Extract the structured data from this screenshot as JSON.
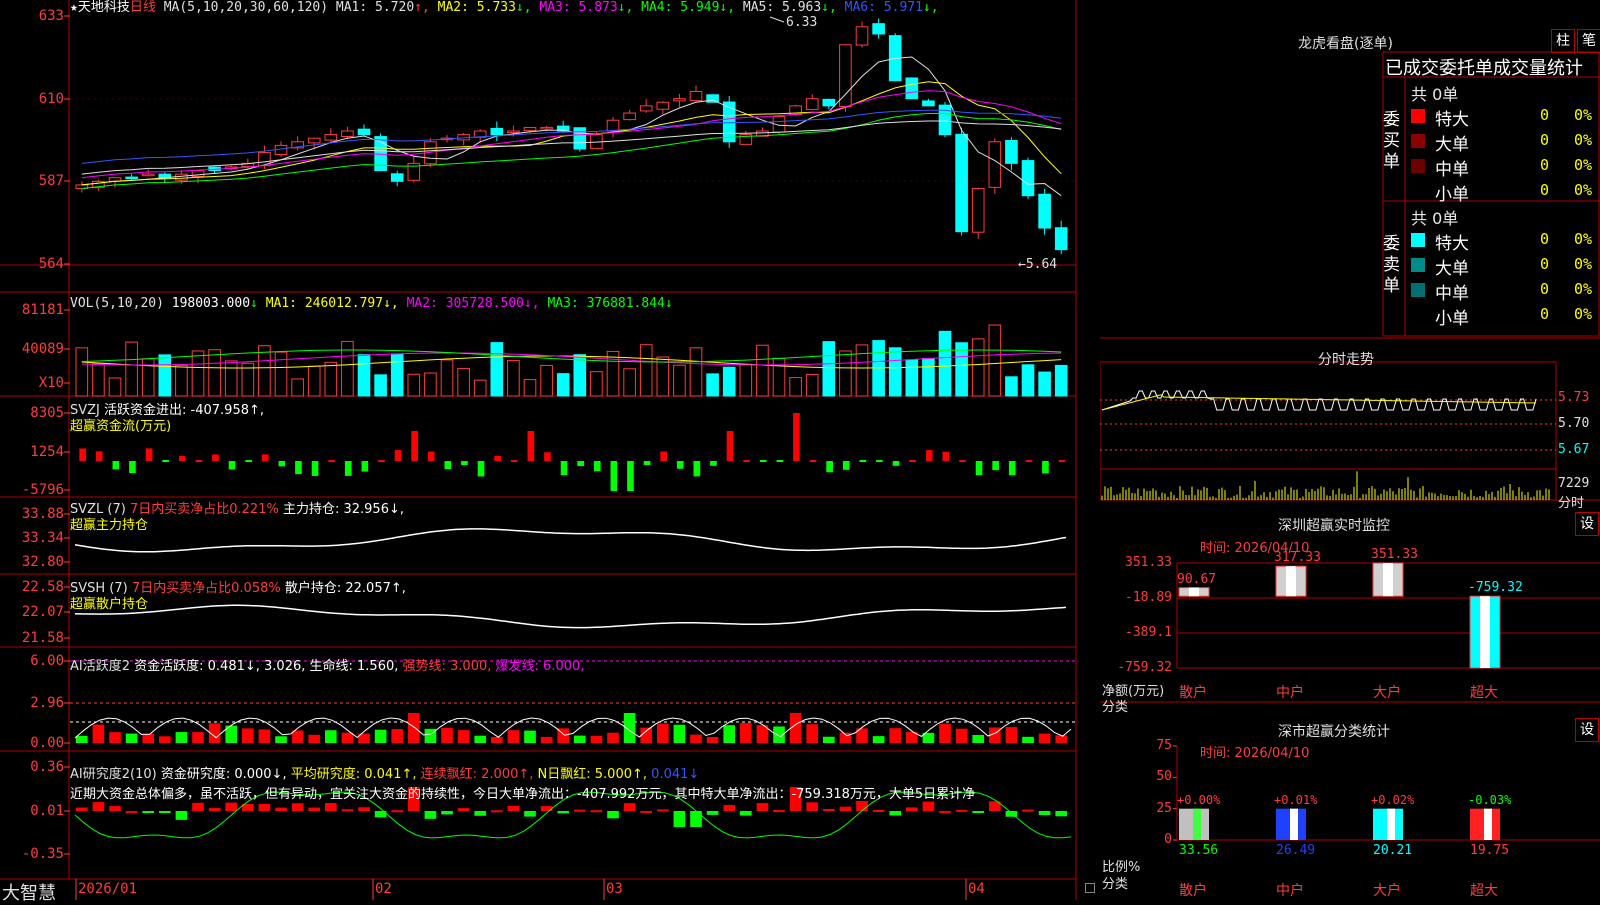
{
  "app": {
    "brand": "大智慧"
  },
  "stock": {
    "star": "★",
    "name": "天地科技",
    "period": "日线"
  },
  "kline_header": {
    "ma_label": "MA(5,10,20,30,60,120)",
    "items": [
      {
        "label": "MA1:",
        "value": "5.720",
        "arrow": "↑",
        "color": "#e0e0e0"
      },
      {
        "label": "MA2:",
        "value": "5.733",
        "arrow": "↓",
        "color": "#ffff00"
      },
      {
        "label": "MA3:",
        "value": "5.873",
        "arrow": "↓",
        "color": "#ff00ff"
      },
      {
        "label": "MA4:",
        "value": "5.949",
        "arrow": "↓",
        "color": "#00ff00"
      },
      {
        "label": "MA5:",
        "value": "5.963",
        "arrow": "↓",
        "color": "#e0e0e0"
      },
      {
        "label": "MA6:",
        "value": "5.971",
        "arrow": "↓",
        "color": "#3355ff"
      }
    ],
    "high_mark": "6.33",
    "low_mark": "←5.64"
  },
  "kline_yaxis": [
    "633",
    "610",
    "587",
    "564"
  ],
  "vol_header": {
    "label": "VOL(5,10,20)",
    "value": "198003.000",
    "arrow": "↓",
    "ma1": "MA1: 246012.797↓,",
    "ma2": "MA2: 305728.500↓,",
    "ma3": "MA3: 376881.844↓"
  },
  "vol_yaxis": [
    "81181",
    "40089",
    "X10"
  ],
  "svzj_header": {
    "label": "SVZJ",
    "text": "活跃资金进出: -407.958↑,",
    "sub": "超赢资金流(万元)"
  },
  "svzj_yaxis": [
    "8305",
    "1254",
    "-5796"
  ],
  "svzl_header": {
    "label": "SVZL (7)",
    "ratio": "7日内买卖净占比0.221%",
    "text": "主力持仓: 32.956↓,",
    "sub": "超赢主力持仓"
  },
  "svzl_yaxis": [
    "33.88",
    "33.34",
    "32.80"
  ],
  "svsh_header": {
    "label": "SVSH (7)",
    "ratio": "7日内买卖净占比0.058%",
    "text": "散户持仓: 22.057↑,",
    "sub": "超赢散户持仓"
  },
  "svsh_yaxis": [
    "22.58",
    "22.07",
    "21.58"
  ],
  "ai1_header": {
    "label": "AI活跃度2",
    "text": "资金活跃度: 0.481↓, 3.026, 生命线: 1.560,",
    "strong": "强势线: 3.000,",
    "burst": "爆发线: 6.000,"
  },
  "ai1_yaxis": [
    "6.00",
    "2.96",
    "0.00"
  ],
  "ai2_header": {
    "label": "AI研究度2(10)",
    "text": "资金研究度: 0.000↓,",
    "avg": "平均研究度: 0.041↑,",
    "cont": "连续飘红: 2.000↑,",
    "nday": "N日飘红: 5.000↑,",
    "last": "0.041↓"
  },
  "ai2_comment": "近期大资金总体偏多，虽不活跃，但有异动，宜关注大资金的持续性，今日大单净流出：-407.992万元，其中特大单净流出：-759.318万元，大单5日累计净",
  "ai2_yaxis": [
    "0.36",
    "0.01",
    "-0.35"
  ],
  "xaxis": [
    "2026/01",
    "02",
    "03",
    "04"
  ],
  "longhu": {
    "title": "龙虎看盘(逐单)",
    "btn_bar": "柱",
    "btn_pen": "笔",
    "subtitle": "已成交委托单成交量统计",
    "buy_side": "委买单",
    "sell_side": "委卖单",
    "buy_total": "共 0单",
    "sell_total": "共 0单",
    "buy_rows": [
      {
        "name": "特大",
        "count": "0",
        "pct": "0%",
        "color": "#ff0000"
      },
      {
        "name": "大单",
        "count": "0",
        "pct": "0%",
        "color": "#8b0000"
      },
      {
        "name": "中单",
        "count": "0",
        "pct": "0%",
        "color": "#6a0000"
      },
      {
        "name": "小单",
        "count": "0",
        "pct": "0%",
        "color": "#000000"
      }
    ],
    "sell_rows": [
      {
        "name": "特大",
        "count": "0",
        "pct": "0%",
        "color": "#00ffff"
      },
      {
        "name": "大单",
        "count": "0",
        "pct": "0%",
        "color": "#008b8b"
      },
      {
        "name": "中单",
        "count": "0",
        "pct": "0%",
        "color": "#006f6f"
      },
      {
        "name": "小单",
        "count": "0",
        "pct": "0%",
        "color": "#000000"
      }
    ]
  },
  "intraday": {
    "title": "分时走势",
    "prices": [
      "5.73",
      "5.70",
      "5.67"
    ],
    "vol": "7229",
    "vol_unit": "分时"
  },
  "sz_monitor": {
    "title": "深圳超赢实时监控",
    "btn": "设",
    "time": "时间: 2026/04/10",
    "yaxis": [
      "351.33",
      "-18.89",
      "-389.1",
      "-759.32"
    ],
    "ylabel": "净额(万元)",
    "xlabel": "分类",
    "categories": [
      "散户",
      "中户",
      "大户",
      "超大"
    ],
    "values": [
      90.67,
      317.33,
      351.33,
      -759.32
    ],
    "value_labels": [
      "90.67",
      "317.33",
      "351.33",
      "-759.32"
    ]
  },
  "sz_class": {
    "title": "深市超赢分类统计",
    "btn": "设",
    "time": "时间: 2026/04/10",
    "yaxis": [
      "75",
      "50",
      "25",
      "0"
    ],
    "ylabel": "比例%",
    "xlabel": "分类",
    "categories": [
      "散户",
      "中户",
      "大户",
      "超大"
    ],
    "values": [
      33.56,
      26.49,
      20.21,
      19.75
    ],
    "changes": [
      "+0.00%",
      "+0.01%",
      "+0.02%",
      "-0.03%"
    ],
    "value_labels": [
      "33.56",
      "26.49",
      "20.21",
      "19.75"
    ]
  },
  "chart_data": [
    {
      "type": "bar",
      "title": "深圳超赢实时监控",
      "categories": [
        "散户",
        "中户",
        "大户",
        "超大"
      ],
      "values": [
        90.67,
        317.33,
        351.33,
        -759.32
      ],
      "ylabel": "净额(万元)",
      "xlabel": "分类",
      "ylim": [
        -759.32,
        351.33
      ]
    },
    {
      "type": "bar",
      "title": "深市超赢分类统计",
      "categories": [
        "散户",
        "中户",
        "大户",
        "超大"
      ],
      "values": [
        33.56,
        26.49,
        20.21,
        19.75
      ],
      "ylabel": "比例%",
      "xlabel": "分类",
      "ylim": [
        0,
        75
      ]
    },
    {
      "type": "line",
      "title": "天地科技 日线",
      "xlabel": "",
      "ylabel": "",
      "x_ticks": [
        "2026/01",
        "02",
        "03",
        "04"
      ],
      "ylim": [
        5.64,
        6.33
      ],
      "series": [
        {
          "name": "MA1",
          "values": [
            5.72
          ]
        },
        {
          "name": "MA2",
          "values": [
            5.733
          ]
        },
        {
          "name": "MA3",
          "values": [
            5.873
          ]
        },
        {
          "name": "MA4",
          "values": [
            5.949
          ]
        },
        {
          "name": "MA5",
          "values": [
            5.963
          ]
        },
        {
          "name": "MA6",
          "values": [
            5.971
          ]
        }
      ]
    }
  ]
}
